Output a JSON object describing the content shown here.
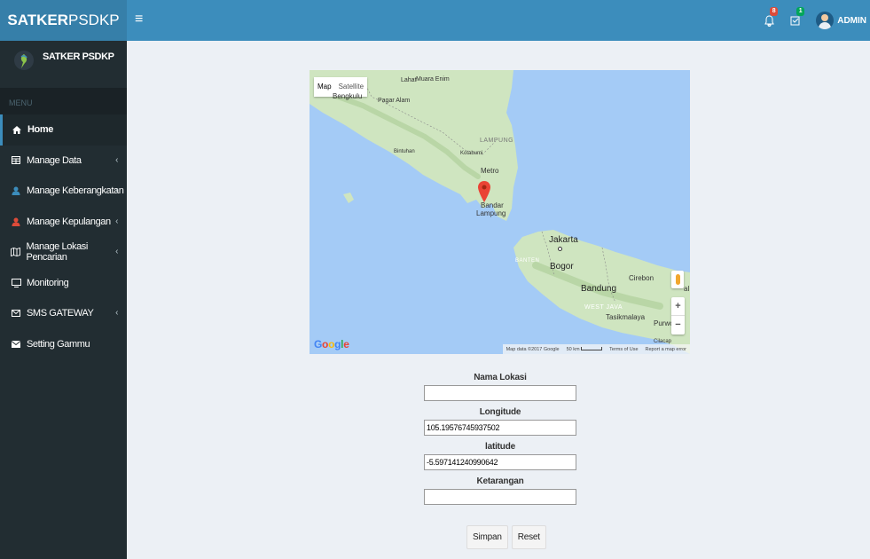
{
  "header": {
    "logo_bold": "SATKER",
    "logo_light": "PSDKP",
    "menu_toggle_icon": "bars-icon",
    "notifications_badge": "8",
    "tasks_badge": "1",
    "user_name": "ADMIN"
  },
  "sidebar": {
    "user_panel_name": "SATKER PSDKP",
    "menu_header": "MENU",
    "items": [
      {
        "label": "Home",
        "icon": "home-icon",
        "caret": "",
        "active": true
      },
      {
        "label": "Manage Data",
        "icon": "table-icon",
        "caret": "‹"
      },
      {
        "label": "Manage Keberangkatan",
        "icon": "user-icon",
        "caret": "‹"
      },
      {
        "label": "Manage Kepulangan",
        "icon": "user-icon",
        "caret": "‹"
      },
      {
        "label": "Manage Lokasi Pencarian",
        "icon": "map-icon",
        "caret": "‹"
      },
      {
        "label": "Monitoring",
        "icon": "desktop-icon",
        "caret": ""
      },
      {
        "label": "SMS GATEWAY",
        "icon": "envelope-icon",
        "caret": "‹"
      },
      {
        "label": "Setting Gammu",
        "icon": "envelope-filled-icon",
        "caret": ""
      }
    ]
  },
  "map": {
    "type_map": "Map",
    "type_satellite": "Satellite",
    "labels": {
      "lahat": "Lahat",
      "muara_enim": "Muara Enim",
      "bengkulu": "Bengkulu",
      "pagar_alam": "Pagar Alam",
      "lampung": "LAMPUNG",
      "bintuhan": "Bintuhan",
      "kotabumi": "Kotabumi",
      "metro": "Metro",
      "bandar": "Bandar",
      "lampung_city": "Lampung",
      "jakarta": "Jakarta",
      "banten": "BANTEN",
      "bogor": "Bogor",
      "cirebon": "Cirebon",
      "bandung": "Bandung",
      "west_java": "WEST JAVA",
      "tasikmalaya": "Tasikmalaya",
      "purwo": "Purwo",
      "cilacap": "Cilacap",
      "al": "al"
    },
    "google_logo": [
      "G",
      "o",
      "o",
      "g",
      "l",
      "e"
    ],
    "attribution": {
      "map_data": "Map data ©2017 Google",
      "scale": "50 km",
      "terms": "Terms of Use",
      "report": "Report a map error"
    },
    "zoom_in": "+",
    "zoom_out": "−"
  },
  "form": {
    "nama_lokasi_label": "Nama Lokasi",
    "nama_lokasi_value": "",
    "longitude_label": "Longitude",
    "longitude_value": "105.19576745937502",
    "latitude_label": "latitude",
    "latitude_value": "-5.597141240990642",
    "keterangan_label": "Ketarangan",
    "keterangan_value": "",
    "submit_label": "Simpan",
    "reset_label": "Reset"
  },
  "colors": {
    "header": "#3c8dbc",
    "logo_bg": "#367fa9",
    "sidebar": "#222d32",
    "content_bg": "#ecf0f5",
    "map_water": "#a4cbf6",
    "map_land": "#cfe5c0"
  }
}
